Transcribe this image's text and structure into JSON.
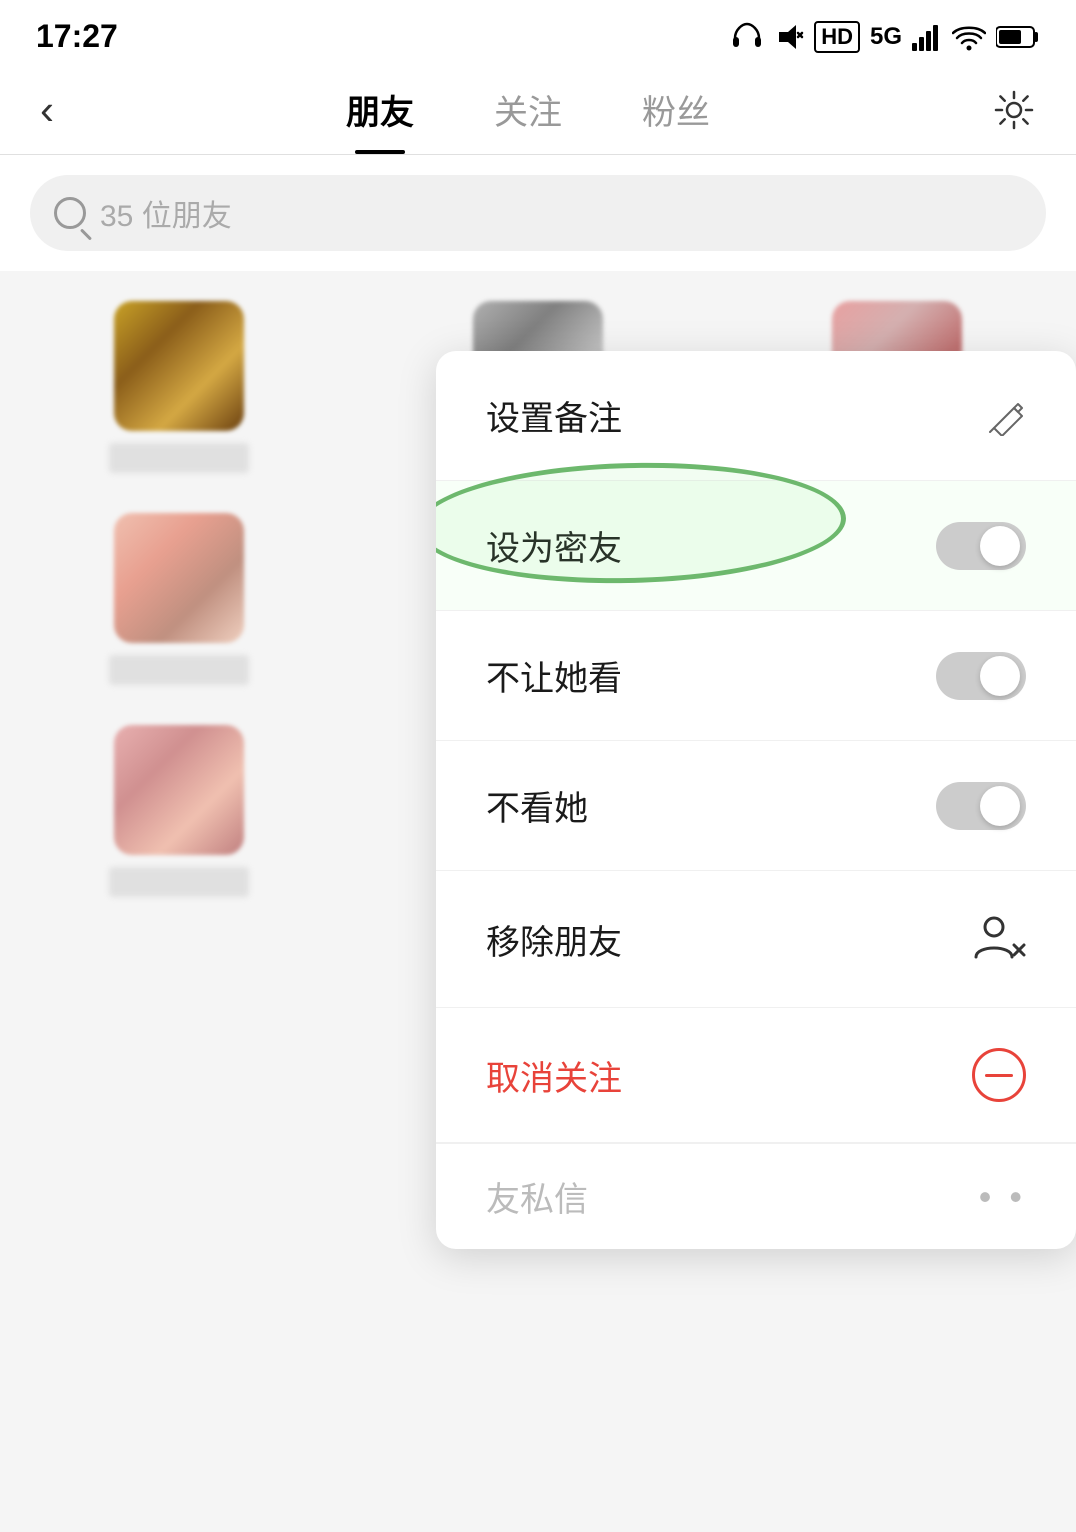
{
  "statusBar": {
    "time": "17:27",
    "icons": [
      "headphone",
      "mute",
      "hd",
      "5g",
      "signal",
      "wifi",
      "battery"
    ]
  },
  "nav": {
    "backLabel": "‹",
    "tabs": [
      {
        "id": "friends",
        "label": "朋友",
        "active": true
      },
      {
        "id": "following",
        "label": "关注",
        "active": false
      },
      {
        "id": "fans",
        "label": "粉丝",
        "active": false
      }
    ],
    "settingsLabel": "⚙"
  },
  "search": {
    "placeholder": "35 位朋友"
  },
  "menu": {
    "items": [
      {
        "id": "set-remark",
        "label": "设置备注",
        "icon": "edit",
        "type": "icon"
      },
      {
        "id": "set-close-friend",
        "label": "设为密友",
        "icon": "toggle",
        "type": "toggle",
        "highlighted": true
      },
      {
        "id": "hide-from-her",
        "label": "不让她看",
        "icon": "toggle",
        "type": "toggle"
      },
      {
        "id": "hide-her",
        "label": "不看她",
        "icon": "toggle",
        "type": "toggle"
      },
      {
        "id": "remove-friend",
        "label": "移除朋友",
        "icon": "person-x",
        "type": "person-x"
      },
      {
        "id": "unfollow",
        "label": "取消关注",
        "icon": "minus-circle",
        "type": "minus-circle",
        "red": true
      }
    ]
  },
  "bottomPartial": {
    "label": "友私信",
    "dots": "•  •"
  },
  "avatars": [
    {
      "id": "a1",
      "style": "golden"
    },
    {
      "id": "a2",
      "style": "gray"
    },
    {
      "id": "a3",
      "style": "pink"
    },
    {
      "id": "a4",
      "style": "charcoal"
    },
    {
      "id": "a5",
      "style": "pink2"
    },
    {
      "id": "a6",
      "style": "dark"
    },
    {
      "id": "a7",
      "style": "pink3"
    },
    {
      "id": "a8",
      "style": "gray2"
    },
    {
      "id": "a9",
      "style": "dark2"
    }
  ]
}
